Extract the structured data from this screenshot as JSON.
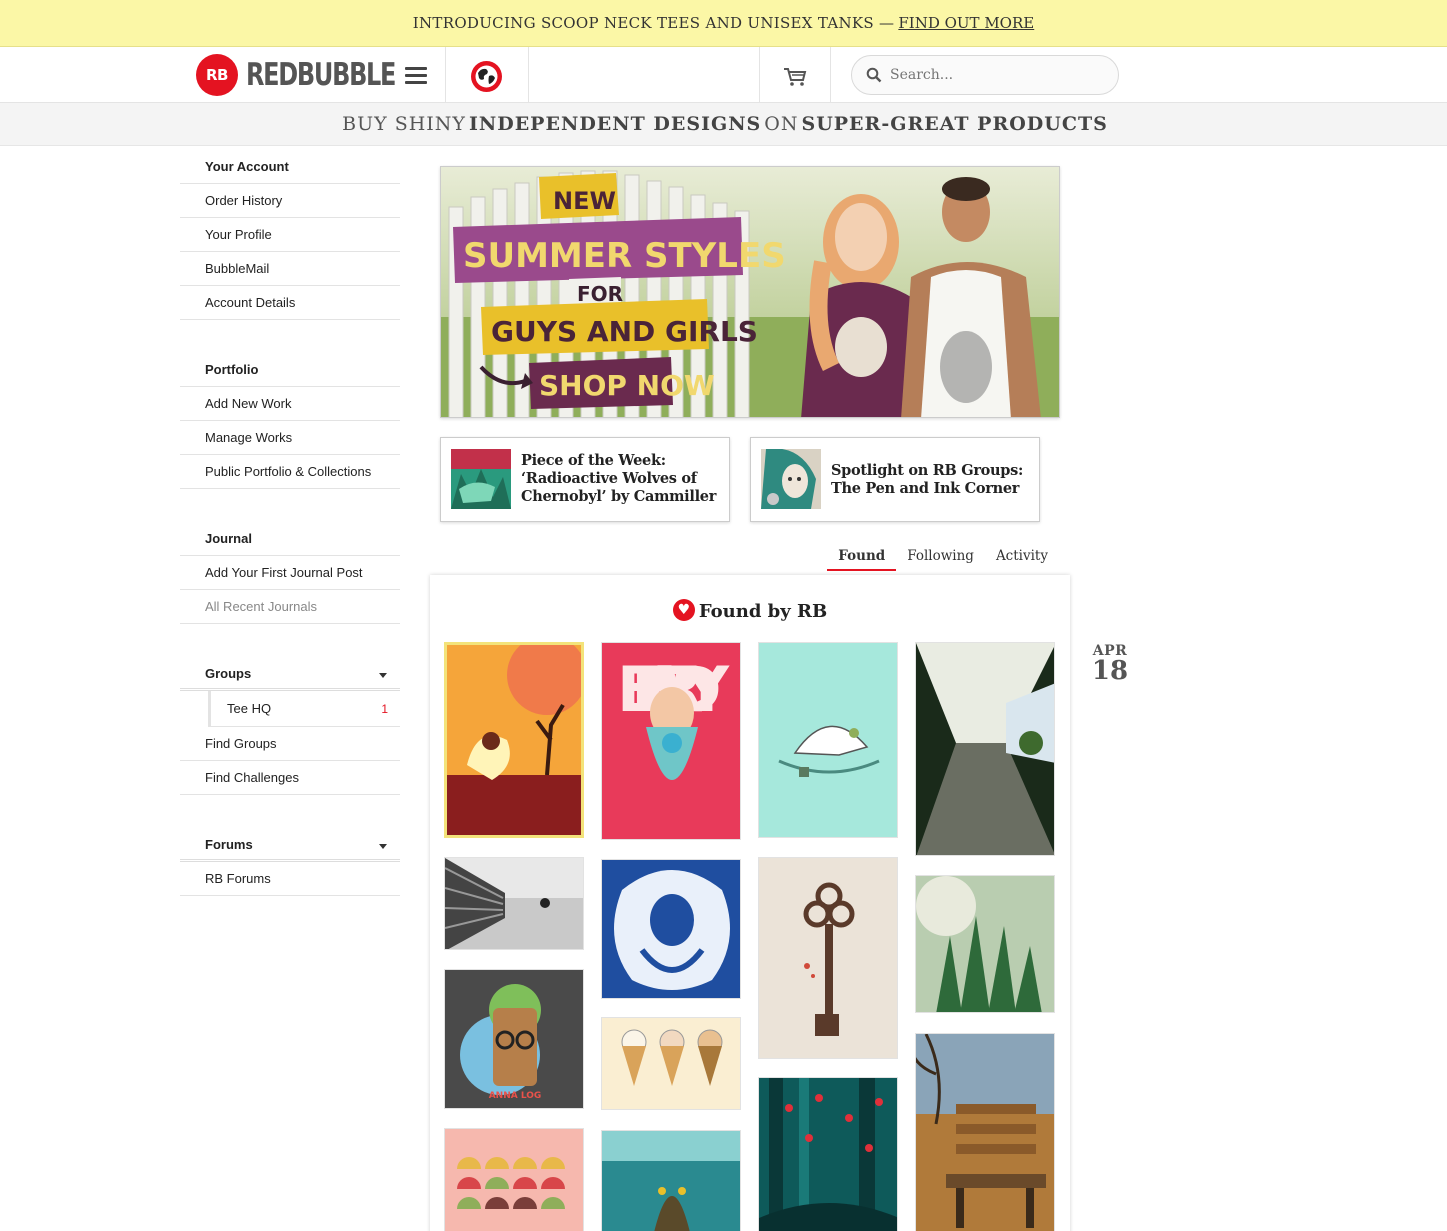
{
  "promo": {
    "text": "INTRODUCING SCOOP NECK TEES AND UNISEX TANKS —",
    "link": "FIND OUT MORE"
  },
  "header": {
    "logo_mark": "RB",
    "logo_text": "REDBUBBLE",
    "search_placeholder": "Search..."
  },
  "tagline": {
    "part1": "BUY SHINY",
    "part2": "INDEPENDENT DESIGNS",
    "part3": "ON",
    "part4": "SUPER-GREAT PRODUCTS"
  },
  "sidebar": {
    "account": {
      "heading": "Your Account",
      "items": [
        "Order History",
        "Your Profile",
        "BubbleMail",
        "Account Details"
      ]
    },
    "portfolio": {
      "heading": "Portfolio",
      "items": [
        "Add New Work",
        "Manage Works",
        "Public Portfolio & Collections"
      ]
    },
    "journal": {
      "heading": "Journal",
      "items": [
        "Add Your First Journal Post",
        "All Recent Journals"
      ]
    },
    "groups": {
      "heading": "Groups",
      "sub_item": "Tee HQ",
      "sub_count": "1",
      "items": [
        "Find Groups",
        "Find Challenges"
      ]
    },
    "forums": {
      "heading": "Forums",
      "items": [
        "RB Forums"
      ]
    }
  },
  "hero": {
    "line1": "NEW",
    "line2": "SUMMER STYLES",
    "line3": "FOR",
    "line4": "GUYS AND GIRLS",
    "line5": "SHOP NOW"
  },
  "cards": [
    {
      "title": "Piece of the Week: ‘Radioactive Wolves of Chernobyl’ by Cammiller"
    },
    {
      "title": "Spotlight on RB Groups: The Pen and Ink Corner"
    }
  ],
  "tabs": [
    "Found",
    "Following",
    "Activity"
  ],
  "panel": {
    "title": "Found by RB"
  },
  "art_text": {
    "beardy": "BEARDY",
    "annalog": "ANNA LOG"
  },
  "date": {
    "month": "APR",
    "day": "18"
  },
  "colors": {
    "brand_red": "#e41321",
    "promo_yellow": "#fbf7a6"
  }
}
